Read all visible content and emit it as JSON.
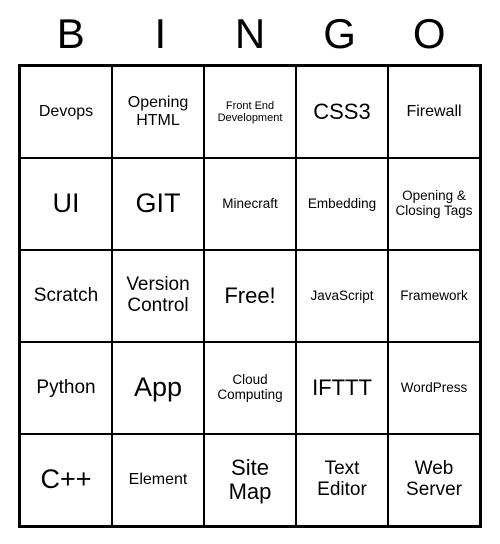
{
  "header": [
    "B",
    "I",
    "N",
    "G",
    "O"
  ],
  "cells": [
    [
      {
        "text": "Devops",
        "size": "fs-s"
      },
      {
        "text": "Opening HTML",
        "size": "fs-s"
      },
      {
        "text": "Front End Development",
        "size": "fs-xxs"
      },
      {
        "text": "CSS3",
        "size": "fs-l"
      },
      {
        "text": "Firewall",
        "size": "fs-s"
      }
    ],
    [
      {
        "text": "UI",
        "size": "fs-xl"
      },
      {
        "text": "GIT",
        "size": "fs-xl"
      },
      {
        "text": "Minecraft",
        "size": "fs-xs"
      },
      {
        "text": "Embedding",
        "size": "fs-xs"
      },
      {
        "text": "Opening & Closing Tags",
        "size": "fs-xs"
      }
    ],
    [
      {
        "text": "Scratch",
        "size": "fs-m"
      },
      {
        "text": "Version Control",
        "size": "fs-m"
      },
      {
        "text": "Free!",
        "size": "fs-l"
      },
      {
        "text": "JavaScript",
        "size": "fs-xs"
      },
      {
        "text": "Framework",
        "size": "fs-xs"
      }
    ],
    [
      {
        "text": "Python",
        "size": "fs-m"
      },
      {
        "text": "App",
        "size": "fs-xl"
      },
      {
        "text": "Cloud Computing",
        "size": "fs-xs"
      },
      {
        "text": "IFTTT",
        "size": "fs-l"
      },
      {
        "text": "WordPress",
        "size": "fs-xs"
      }
    ],
    [
      {
        "text": "C++",
        "size": "fs-xl"
      },
      {
        "text": "Element",
        "size": "fs-s"
      },
      {
        "text": "Site Map",
        "size": "fs-l"
      },
      {
        "text": "Text Editor",
        "size": "fs-m"
      },
      {
        "text": "Web Server",
        "size": "fs-m"
      }
    ]
  ]
}
